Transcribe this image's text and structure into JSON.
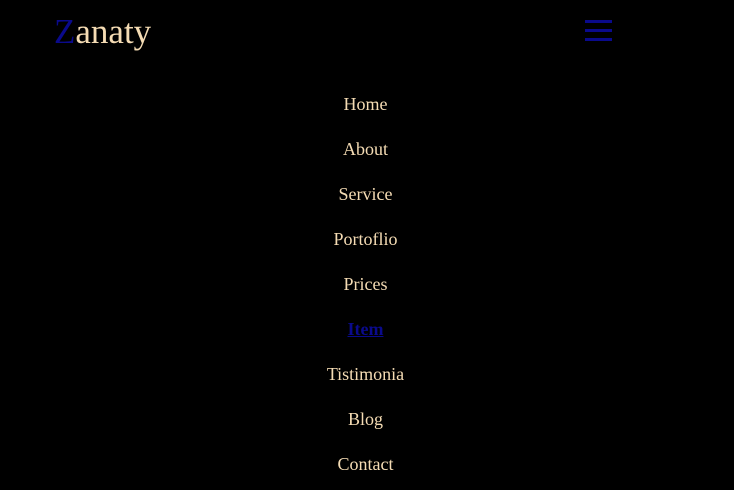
{
  "brand": {
    "first_letter": "Z",
    "rest": "anaty"
  },
  "menu_toggle": {
    "icon": "hamburger-icon",
    "color": "#0a0a8c"
  },
  "nav": {
    "items": [
      {
        "label": "Home"
      },
      {
        "label": "About"
      },
      {
        "label": "Service"
      },
      {
        "label": "Portoflio"
      },
      {
        "label": "Prices"
      },
      {
        "label": "Item",
        "active": true
      },
      {
        "label": "Tistimonia"
      },
      {
        "label": "Blog"
      },
      {
        "label": "Contact"
      }
    ]
  },
  "colors": {
    "background": "#000000",
    "text": "#f5dcb4",
    "accent": "#0a0a8c"
  }
}
